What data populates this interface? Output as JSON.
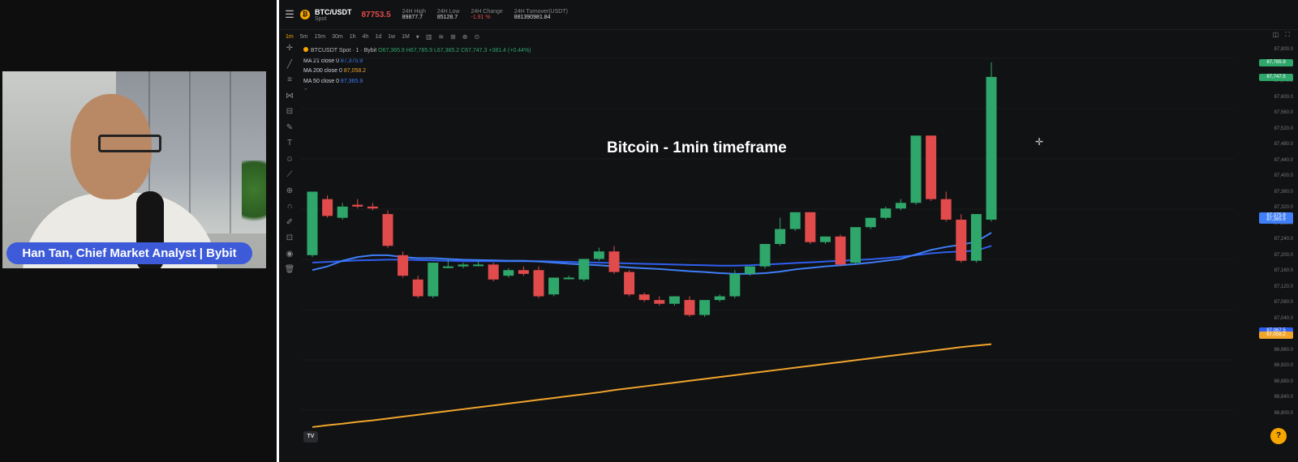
{
  "presenter": {
    "name_badge": "Han Tan, Chief Market Analyst | Bybit"
  },
  "header": {
    "menu_icon": "hamburger-icon",
    "pair": "BTC/USDT",
    "pair_type": "Spot",
    "last_price": "87753.5",
    "stats": [
      {
        "label": "24H High",
        "value": "89877.7",
        "negative": false
      },
      {
        "label": "24H Low",
        "value": "85128.7",
        "negative": false
      },
      {
        "label": "24H Change",
        "value": "-1.91 %",
        "negative": true
      },
      {
        "label": "24H Turnover(USDT)",
        "value": "881390981.84",
        "negative": false
      }
    ]
  },
  "timeframes": [
    "1m",
    "5m",
    "15m",
    "30m",
    "1h",
    "4h",
    "1d",
    "1w",
    "1M"
  ],
  "active_timeframe": "1m",
  "legend": {
    "symbol_line": "BTCUSDT Spot · 1 · Bybit",
    "ohlc": "O67,365.9 H67,785.9 L67,365.2 C67,747.3 +381.4 (+0.44%)",
    "ma21_label": "MA 21 close 0",
    "ma21_value": "87,375.9",
    "ma200_label": "MA 200 close 0",
    "ma200_value": "87,058.2",
    "ma50_label": "MA 50 close 0",
    "ma50_value": "87,365.9"
  },
  "overlay_title": "Bitcoin - 1min timeframe",
  "colors": {
    "up": "#2fa66a",
    "down": "#e14b4b",
    "ma21": "#3f7ef6",
    "ma50": "#2f5ff0",
    "ma200": "#f0a52c",
    "badge": "#3d5bd9",
    "accent": "#f7a600"
  },
  "chart_data": {
    "type": "candlestick",
    "title": "",
    "ylim": [
      86760,
      87840
    ],
    "candles": [
      {
        "o": 87270,
        "h": 87440,
        "c": 87440
      },
      {
        "o": 87420,
        "h": 87430,
        "c": 87375
      },
      {
        "o": 87370,
        "h": 87410,
        "c": 87400
      },
      {
        "o": 87405,
        "h": 87420,
        "c": 87400
      },
      {
        "o": 87400,
        "h": 87410,
        "c": 87395
      },
      {
        "o": 87380,
        "h": 87390,
        "c": 87295
      },
      {
        "o": 87270,
        "h": 87280,
        "c": 87215
      },
      {
        "o": 87205,
        "h": 87215,
        "c": 87160
      },
      {
        "o": 87160,
        "h": 87250,
        "c": 87250
      },
      {
        "o": 87240,
        "h": 87260,
        "c": 87240
      },
      {
        "o": 87240,
        "h": 87250,
        "c": 87245
      },
      {
        "o": 87245,
        "h": 87255,
        "c": 87245
      },
      {
        "o": 87245,
        "h": 87250,
        "c": 87205
      },
      {
        "o": 87215,
        "h": 87235,
        "c": 87230
      },
      {
        "o": 87230,
        "h": 87240,
        "c": 87220
      },
      {
        "o": 87230,
        "h": 87240,
        "c": 87160
      },
      {
        "o": 87165,
        "h": 87210,
        "c": 87210
      },
      {
        "o": 87210,
        "h": 87215,
        "c": 87210
      },
      {
        "o": 87205,
        "h": 87260,
        "c": 87260
      },
      {
        "o": 87260,
        "h": 87290,
        "c": 87280
      },
      {
        "o": 87280,
        "h": 87295,
        "c": 87225
      },
      {
        "o": 87225,
        "h": 87230,
        "c": 87165
      },
      {
        "o": 87165,
        "h": 87170,
        "c": 87150
      },
      {
        "o": 87150,
        "h": 87160,
        "c": 87140
      },
      {
        "o": 87140,
        "h": 87160,
        "c": 87160
      },
      {
        "o": 87150,
        "h": 87160,
        "c": 87110
      },
      {
        "o": 87110,
        "h": 87150,
        "c": 87150
      },
      {
        "o": 87150,
        "h": 87165,
        "c": 87160
      },
      {
        "o": 87160,
        "h": 87230,
        "c": 87220
      },
      {
        "o": 87220,
        "h": 87240,
        "c": 87240
      },
      {
        "o": 87240,
        "h": 87300,
        "c": 87300
      },
      {
        "o": 87300,
        "h": 87370,
        "c": 87340
      },
      {
        "o": 87340,
        "h": 87385,
        "c": 87385
      },
      {
        "o": 87385,
        "h": 87385,
        "c": 87305
      },
      {
        "o": 87305,
        "h": 87320,
        "c": 87320
      },
      {
        "o": 87320,
        "h": 87325,
        "c": 87245
      },
      {
        "o": 87250,
        "h": 87345,
        "c": 87345
      },
      {
        "o": 87345,
        "h": 87370,
        "c": 87370
      },
      {
        "o": 87370,
        "h": 87400,
        "c": 87395
      },
      {
        "o": 87395,
        "h": 87420,
        "c": 87410
      },
      {
        "o": 87410,
        "h": 87590,
        "c": 87590
      },
      {
        "o": 87590,
        "h": 87590,
        "c": 87420
      },
      {
        "o": 87420,
        "h": 87440,
        "c": 87365
      },
      {
        "o": 87365,
        "h": 87380,
        "c": 87255
      },
      {
        "o": 87255,
        "h": 87380,
        "c": 87380
      },
      {
        "o": 87365,
        "h": 87786,
        "c": 87747
      }
    ],
    "ma21": [
      87230,
      87240,
      87255,
      87265,
      87270,
      87270,
      87265,
      87262,
      87262,
      87260,
      87258,
      87257,
      87256,
      87255,
      87255,
      87253,
      87250,
      87247,
      87245,
      87243,
      87240,
      87237,
      87235,
      87233,
      87230,
      87227,
      87225,
      87222,
      87220,
      87220,
      87222,
      87226,
      87232,
      87236,
      87240,
      87243,
      87246,
      87250,
      87255,
      87260,
      87272,
      87284,
      87292,
      87298,
      87306,
      87330
    ],
    "ma50": [
      87250,
      87252,
      87254,
      87256,
      87257,
      87258,
      87258,
      87257,
      87256,
      87255,
      87254,
      87254,
      87254,
      87254,
      87254,
      87254,
      87253,
      87252,
      87251,
      87250,
      87249,
      87248,
      87247,
      87246,
      87245,
      87244,
      87243,
      87242,
      87242,
      87243,
      87245,
      87247,
      87249,
      87251,
      87253,
      87255,
      87257,
      87259,
      87262,
      87266,
      87270,
      87275,
      87278,
      87280,
      87282,
      87295
    ],
    "ma200": [
      86810,
      86815,
      86819,
      86824,
      86828,
      86833,
      86838,
      86843,
      86848,
      86853,
      86858,
      86863,
      86868,
      86873,
      86878,
      86883,
      86888,
      86893,
      86898,
      86903,
      86909,
      86914,
      86919,
      86924,
      86929,
      86934,
      86939,
      86944,
      86949,
      86954,
      86959,
      86964,
      86969,
      86974,
      86979,
      86984,
      86989,
      86994,
      86999,
      87004,
      87009,
      87014,
      87019,
      87024,
      87028,
      87032
    ]
  },
  "y_ticks": [
    "87,800.0",
    "87,760.0",
    "87,640.0",
    "87,600.0",
    "87,560.0",
    "87,520.0",
    "87,480.0",
    "87,440.0",
    "87,400.0",
    "87,360.0",
    "87,320.0",
    "87,280.0",
    "87,240.0",
    "87,200.0",
    "87,160.0",
    "87,120.0",
    "87,080.0",
    "87,040.0",
    "87,000.0",
    "86,960.0",
    "86,920.0",
    "86,880.0",
    "86,840.0",
    "86,800.0"
  ],
  "price_tags": {
    "high": "87,785.9",
    "last": "87,747.5",
    "ma21": "87,375.9",
    "ma50": "87,365.9",
    "low": "87,067.5",
    "ma200": "87,058.2"
  },
  "tv_logo_text": "TV"
}
